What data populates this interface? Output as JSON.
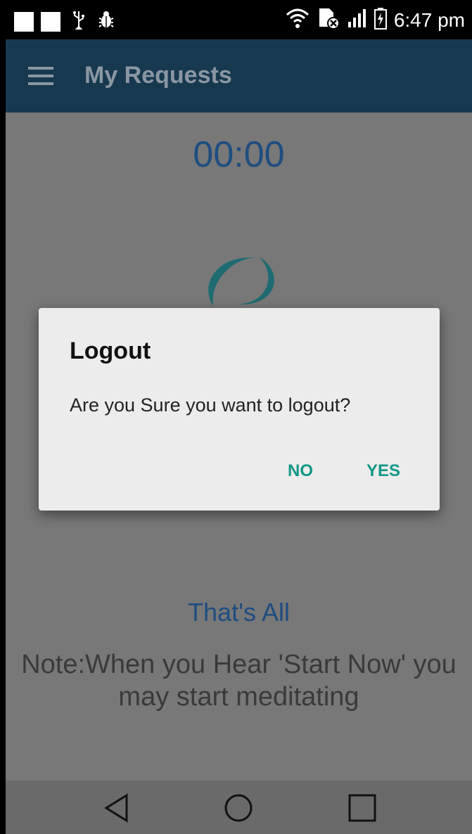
{
  "status_bar": {
    "time": "6:47 pm",
    "icons": [
      "notification-square",
      "notification-square",
      "usb-icon",
      "bug-icon",
      "wifi-icon",
      "sim-error-icon",
      "signal-icon",
      "battery-charging-icon"
    ]
  },
  "app_bar": {
    "title": "My Requests",
    "menu_icon": "hamburger-menu-icon"
  },
  "main": {
    "timer": "00:00",
    "logo_icon": "meditation-figure-logo",
    "completion_text": "That's All",
    "note": "Note:When you Hear 'Start Now' you may start meditating"
  },
  "dialog": {
    "title": "Logout",
    "message": "Are you Sure you want to logout?",
    "no_label": "NO",
    "yes_label": "YES"
  },
  "nav_bar": {
    "icons": [
      "back-icon",
      "home-icon",
      "recents-icon"
    ]
  },
  "colors": {
    "app_bar": "#17394f",
    "accent_button": "#129888",
    "timer_text": "#1f4d80",
    "logo": "#1e6b71"
  }
}
